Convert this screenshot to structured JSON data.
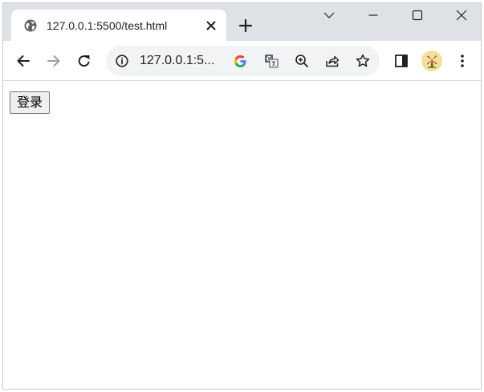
{
  "tab": {
    "title": "127.0.0.1:5500/test.html",
    "favicon": "globe-icon"
  },
  "window_controls": {
    "icons": [
      "chevron-down-icon",
      "minimize-icon",
      "maximize-icon",
      "close-icon"
    ]
  },
  "omnibox": {
    "url": "127.0.0.1:5..."
  },
  "page": {
    "login_button": "登录"
  },
  "colors": {
    "tabstrip": "#dee1e6",
    "omnibox": "#f1f3f4",
    "icon": "#5f6368",
    "avatar": "#f3df9a"
  }
}
